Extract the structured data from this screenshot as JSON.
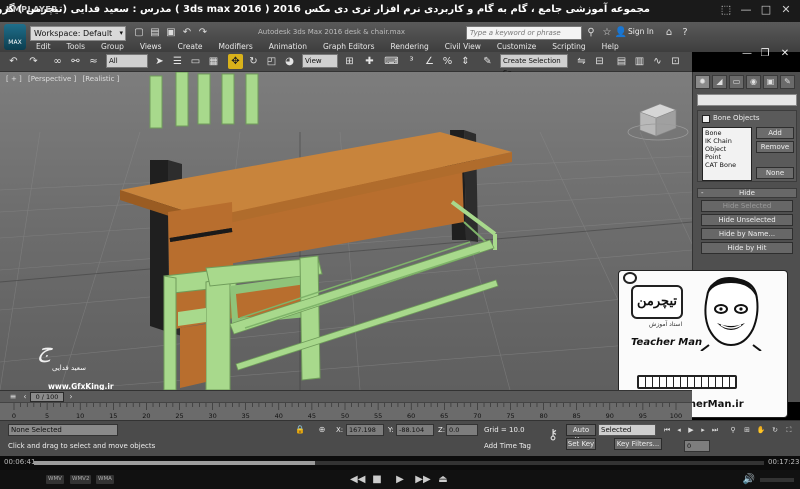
{
  "player": {
    "logo": "KMPLAYER",
    "caption": "مجموعه آموزشی جامع ، گام به گام و کاربردی نرم افزار تری دی مکس 2016 ( 3ds max 2016 )   مدرس : سعید فدایی (تیچرمن ) گروه آموزشی پادشاه گرافیست ها",
    "time_elapsed": "00:06:41",
    "time_total": "00:17:23",
    "progress_fraction": 0.385,
    "tags": [
      "WMV",
      "WMV2",
      "WMA"
    ],
    "controls": {
      "prev": "◀◀",
      "play": "▶",
      "stop": "■",
      "next": "▶▶",
      "eject": "⏏"
    },
    "window_icons": {
      "pin": "⬚",
      "min": "—",
      "max": "□",
      "close": "✕"
    }
  },
  "max": {
    "logo_text": "MAX",
    "workspace": "Workspace: Default",
    "doc_title": "Autodesk 3ds Max 2016   desk & chair.max",
    "search_placeholder": "Type a keyword or phrase",
    "sign_in": "Sign In",
    "menu": [
      "Edit",
      "Tools",
      "Group",
      "Views",
      "Create",
      "Modifiers",
      "Animation",
      "Graph Editors",
      "Rendering",
      "Civil View",
      "Customize",
      "Scripting",
      "Help"
    ],
    "toolbar": {
      "filter": "All",
      "ref_coord": "View",
      "selection_set": "Create Selection Se"
    },
    "viewport": {
      "labels": [
        "[ + ]",
        "[Perspective ]",
        "[Realistic ]"
      ]
    },
    "command_panel": {
      "tabs": [
        "✹",
        "◢",
        "▭",
        "◉",
        "▣",
        "✎"
      ],
      "bone_objects": {
        "title": "Bone Objects",
        "list": [
          "Bone",
          "IK Chain Object",
          "Point",
          "CAT Bone"
        ],
        "add": "Add",
        "remove": "Remove",
        "none": "None"
      },
      "hide": {
        "section": "Hide",
        "toggle": "-",
        "buttons": [
          "Hide Selected",
          "Hide Unselected",
          "Hide by Name...",
          "Hide by Hit"
        ]
      }
    },
    "time": {
      "frame": "0 / 100",
      "ticks": [
        "0",
        "5",
        "10",
        "15",
        "20",
        "25",
        "30",
        "35",
        "40",
        "45",
        "50",
        "55",
        "60",
        "65",
        "70",
        "75",
        "80",
        "85",
        "90",
        "95",
        "100"
      ]
    },
    "status": {
      "selection": "None Selected",
      "prompt": "Click and drag to select and move objects",
      "x_label": "X:",
      "x": "167.198",
      "y_label": "Y:",
      "y": "-88.104",
      "z_label": "Z:",
      "z": "0.0",
      "grid": "Grid = 10.0",
      "add_time_tag": "Add Time Tag",
      "auto_key": "Auto Key",
      "set_key": "Set Key",
      "key_selected": "Selected",
      "key_filters": "Key Filters...",
      "frame_field": "0"
    }
  },
  "watermarks": {
    "signature": "ج",
    "author_name": "سعید فدایی",
    "site_left": "www.GfxKing.ir",
    "tm_logo": "تیچرمن",
    "tm_tagline": "استاد آموزش",
    "tm_name": "Teacher Man",
    "tm_url": "www.TeacherMan.ir"
  },
  "colors": {
    "desk_top": "#c8843c",
    "desk_front": "#b86e2e",
    "desk_frame": "#1a1a1a",
    "chair": "#a8d98c",
    "auto_key_active": "#d9b21a"
  }
}
